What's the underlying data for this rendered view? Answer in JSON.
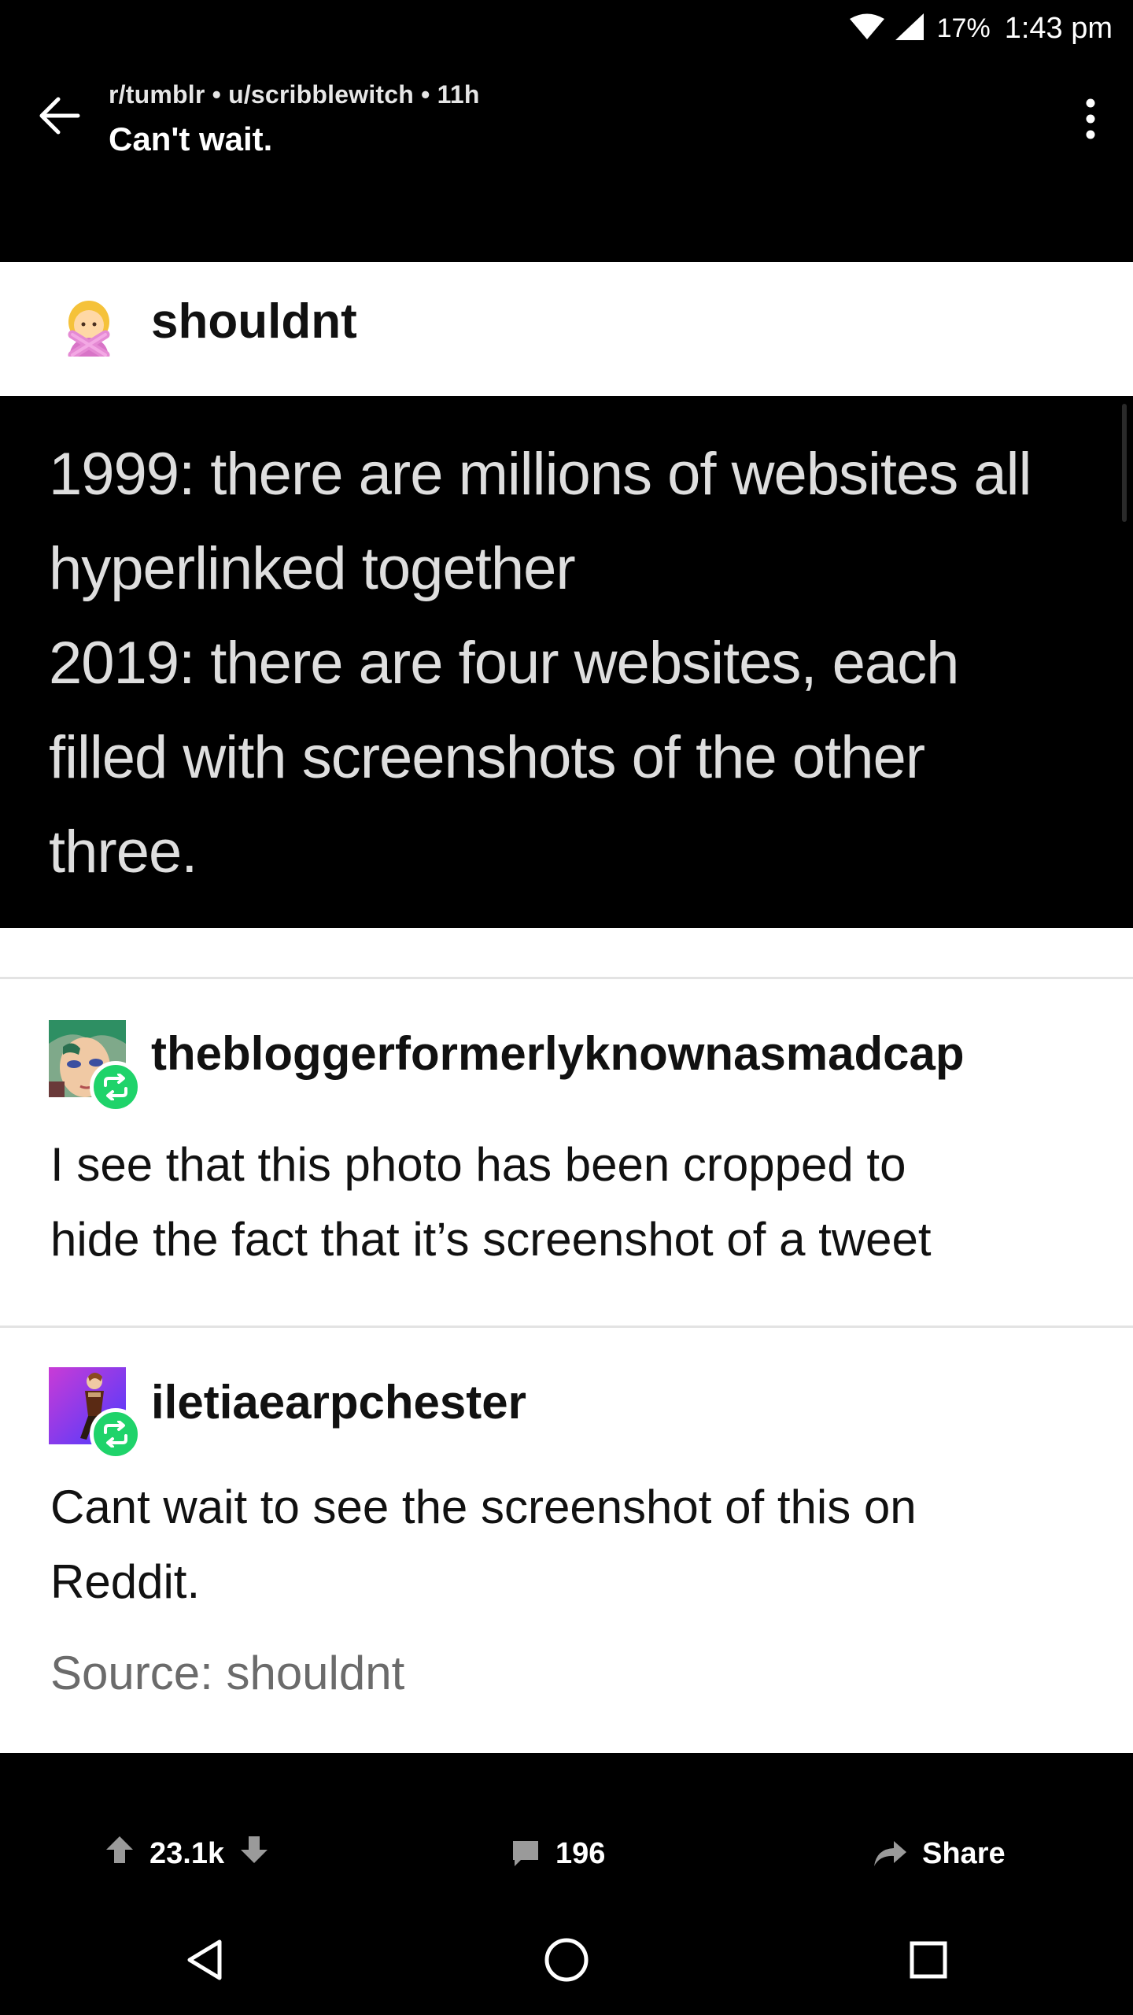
{
  "status_bar": {
    "battery": "17%",
    "time": "1:43 pm"
  },
  "header": {
    "meta": "r/tumblr • u/scribblewitch • 11h",
    "title": "Can't wait."
  },
  "post": {
    "blog_name": "shouldnt",
    "image_text_lines": [
      "1999: there are millions of websites all",
      "hyperlinked together",
      "2019: there are four websites, each",
      "filled with screenshots of the other",
      "three."
    ],
    "reblogs": [
      {
        "username": "thebloggerformerlyknownasmadcap",
        "lines": [
          "I see that this photo has been cropped to",
          "hide the fact that it’s screenshot of a tweet"
        ]
      },
      {
        "username": "iletiaearpchester",
        "lines": [
          "Cant wait to see the screenshot of this on",
          "Reddit."
        ]
      }
    ],
    "source": "Source: shouldnt"
  },
  "actions": {
    "score": "23.1k",
    "comments": "196",
    "share": "Share"
  },
  "colors": {
    "reblog_badge": "#1fd36a",
    "source_text": "#6b6b6b"
  },
  "icons": [
    "wifi-icon",
    "signal-icon",
    "back-arrow-icon",
    "more-vert-icon",
    "no-gesture-emoji-icon",
    "reblog-icon",
    "upvote-icon",
    "downvote-icon",
    "comment-icon",
    "share-icon",
    "nav-back-icon",
    "nav-home-icon",
    "nav-recents-icon"
  ]
}
